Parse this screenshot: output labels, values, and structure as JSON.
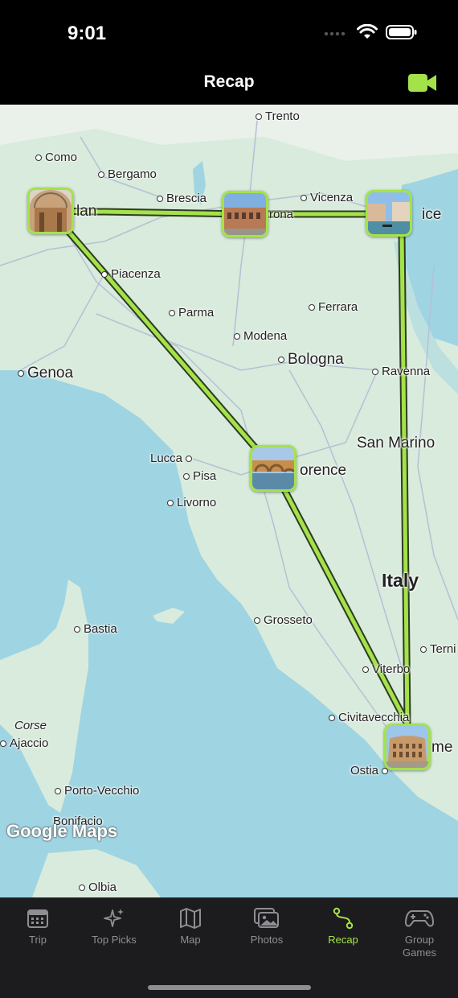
{
  "status": {
    "time": "9:01"
  },
  "nav": {
    "title": "Recap",
    "action_icon": "video-camera-icon",
    "accent": "#a4e24a"
  },
  "map": {
    "watermark": "Google Maps",
    "places": {
      "trento": "Trento",
      "como": "Como",
      "bergamo": "Bergamo",
      "milan": "lan",
      "brescia": "Brescia",
      "verona": "rona",
      "vicenza": "Vicenza",
      "venice": "ice",
      "piacenza": "Piacenza",
      "parma": "Parma",
      "ferrara": "Ferrara",
      "modena": "Modena",
      "bologna": "Bologna",
      "genoa": "Genoa",
      "ravenna": "Ravenna",
      "san_marino": "San Marino",
      "lucca": "Lucca",
      "pisa": "Pisa",
      "florence": "orence",
      "livorno": "Livorno",
      "italy": "Italy",
      "bastia": "Bastia",
      "grosseto": "Grosseto",
      "terni": "Terni",
      "viterbo": "Viterbo",
      "corse": "Corse",
      "ajaccio": "Ajaccio",
      "civitavecchia": "Civitavecchia",
      "rome": "me",
      "ostia": "Ostia",
      "porto_vecchio": "Porto-Vecchio",
      "bonifacio": "Bonifacio",
      "olbia": "Olbia"
    },
    "route_stops": [
      "Milan",
      "Verona",
      "Venice",
      "Rome",
      "Florence"
    ]
  },
  "tabs": [
    {
      "label": "Trip",
      "icon": "calendar-icon",
      "active": false
    },
    {
      "label": "Top Picks",
      "icon": "sparkles-icon",
      "active": false
    },
    {
      "label": "Map",
      "icon": "map-icon",
      "active": false
    },
    {
      "label": "Photos",
      "icon": "photos-icon",
      "active": false
    },
    {
      "label": "Recap",
      "icon": "route-icon",
      "active": true
    },
    {
      "label": "Group\nGames",
      "icon": "game-controller-icon",
      "active": false
    }
  ]
}
